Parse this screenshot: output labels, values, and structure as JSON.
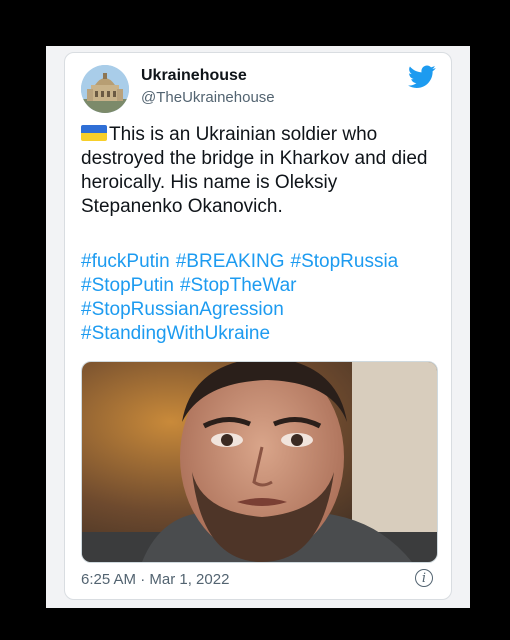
{
  "tweet": {
    "display_name": "Ukrainehouse",
    "handle": "@TheUkrainehouse",
    "flag_icon": "ukraine-flag-emoji",
    "body": "This is an Ukrainian soldier who destroyed the bridge in Kharkov and died heroically. His name is Oleksiy Stepanenko Okanovich.",
    "hashtags": [
      "#fuckPutin",
      "#BREAKING",
      "#StopRussia",
      "#StopPutin",
      "#StopTheWar",
      "#StopRussianAgression",
      "#StandingWithUkraine"
    ],
    "timestamp": "6:25 AM · Mar 1, 2022",
    "info_icon": "i"
  },
  "colors": {
    "link": "#1d9bf0",
    "twitter_blue": "#1d9bf0",
    "flag_blue": "#2f6fd6",
    "flag_yellow": "#f7cf2a"
  },
  "icons": [
    "twitter-bird-icon",
    "info-icon"
  ]
}
